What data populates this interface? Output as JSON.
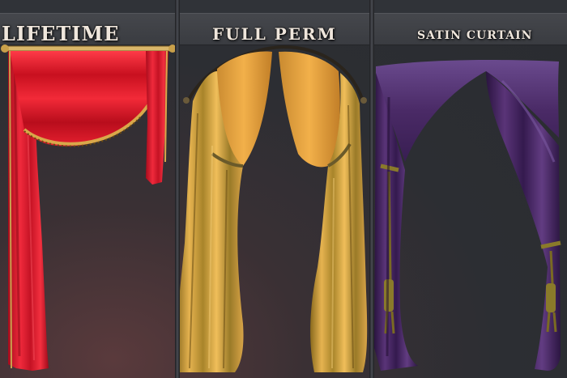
{
  "panels": [
    {
      "title": "LIFETIME",
      "image": "red-curtain"
    },
    {
      "title": "FULL PERM",
      "image": "gold-curtain"
    },
    {
      "title": "SATIN CURTAIN",
      "image": "purple-curtain"
    }
  ],
  "colors": {
    "background": "#2c2e33",
    "red_curtain": "#e0182e",
    "gold_curtain": "#d9a24a",
    "purple_curtain": "#4a2a63",
    "title_text": "#efe6dc"
  }
}
